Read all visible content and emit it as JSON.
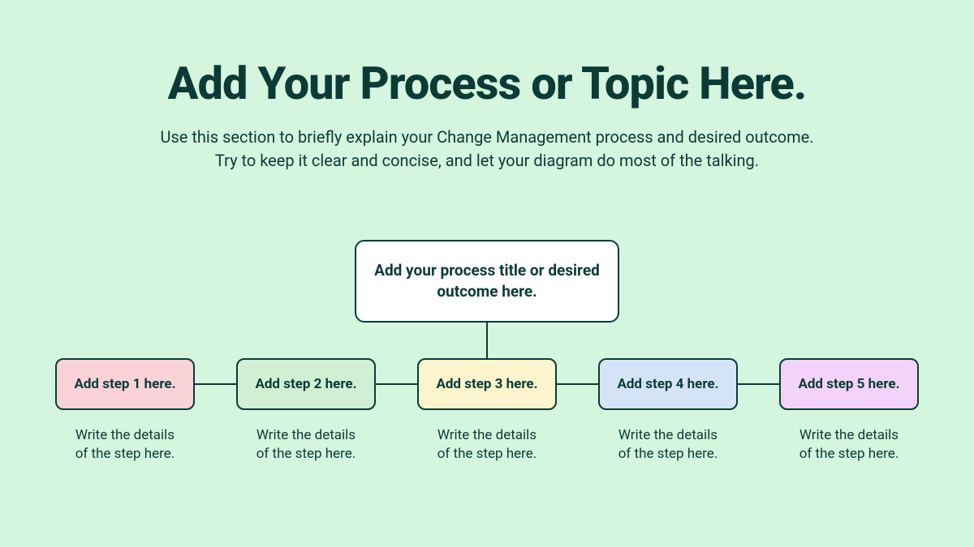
{
  "title": "Add Your Process or Topic Here.",
  "subtitle_line1": "Use this section to briefly explain your Change Management process and desired outcome.",
  "subtitle_line2": "Try to keep it clear and concise, and let your diagram do most of the talking.",
  "outcome": "Add your process title or desired outcome here.",
  "steps": [
    {
      "label": "Add step 1 here.",
      "detail_l1": "Write the details",
      "detail_l2": "of the step here."
    },
    {
      "label": "Add step 2 here.",
      "detail_l1": "Write the details",
      "detail_l2": "of the step here."
    },
    {
      "label": "Add step 3 here.",
      "detail_l1": "Write the details",
      "detail_l2": "of the step here."
    },
    {
      "label": "Add step 4 here.",
      "detail_l1": "Write the details",
      "detail_l2": "of the step here."
    },
    {
      "label": "Add step 5 here.",
      "detail_l1": "Write the details",
      "detail_l2": "of the step here."
    }
  ],
  "colors": {
    "background": "#d4f5de",
    "text": "#0c3b36",
    "step_fills": [
      "#f9d2d8",
      "#d0f0d3",
      "#fcf4cc",
      "#d4e4f7",
      "#f3d3f9"
    ]
  }
}
